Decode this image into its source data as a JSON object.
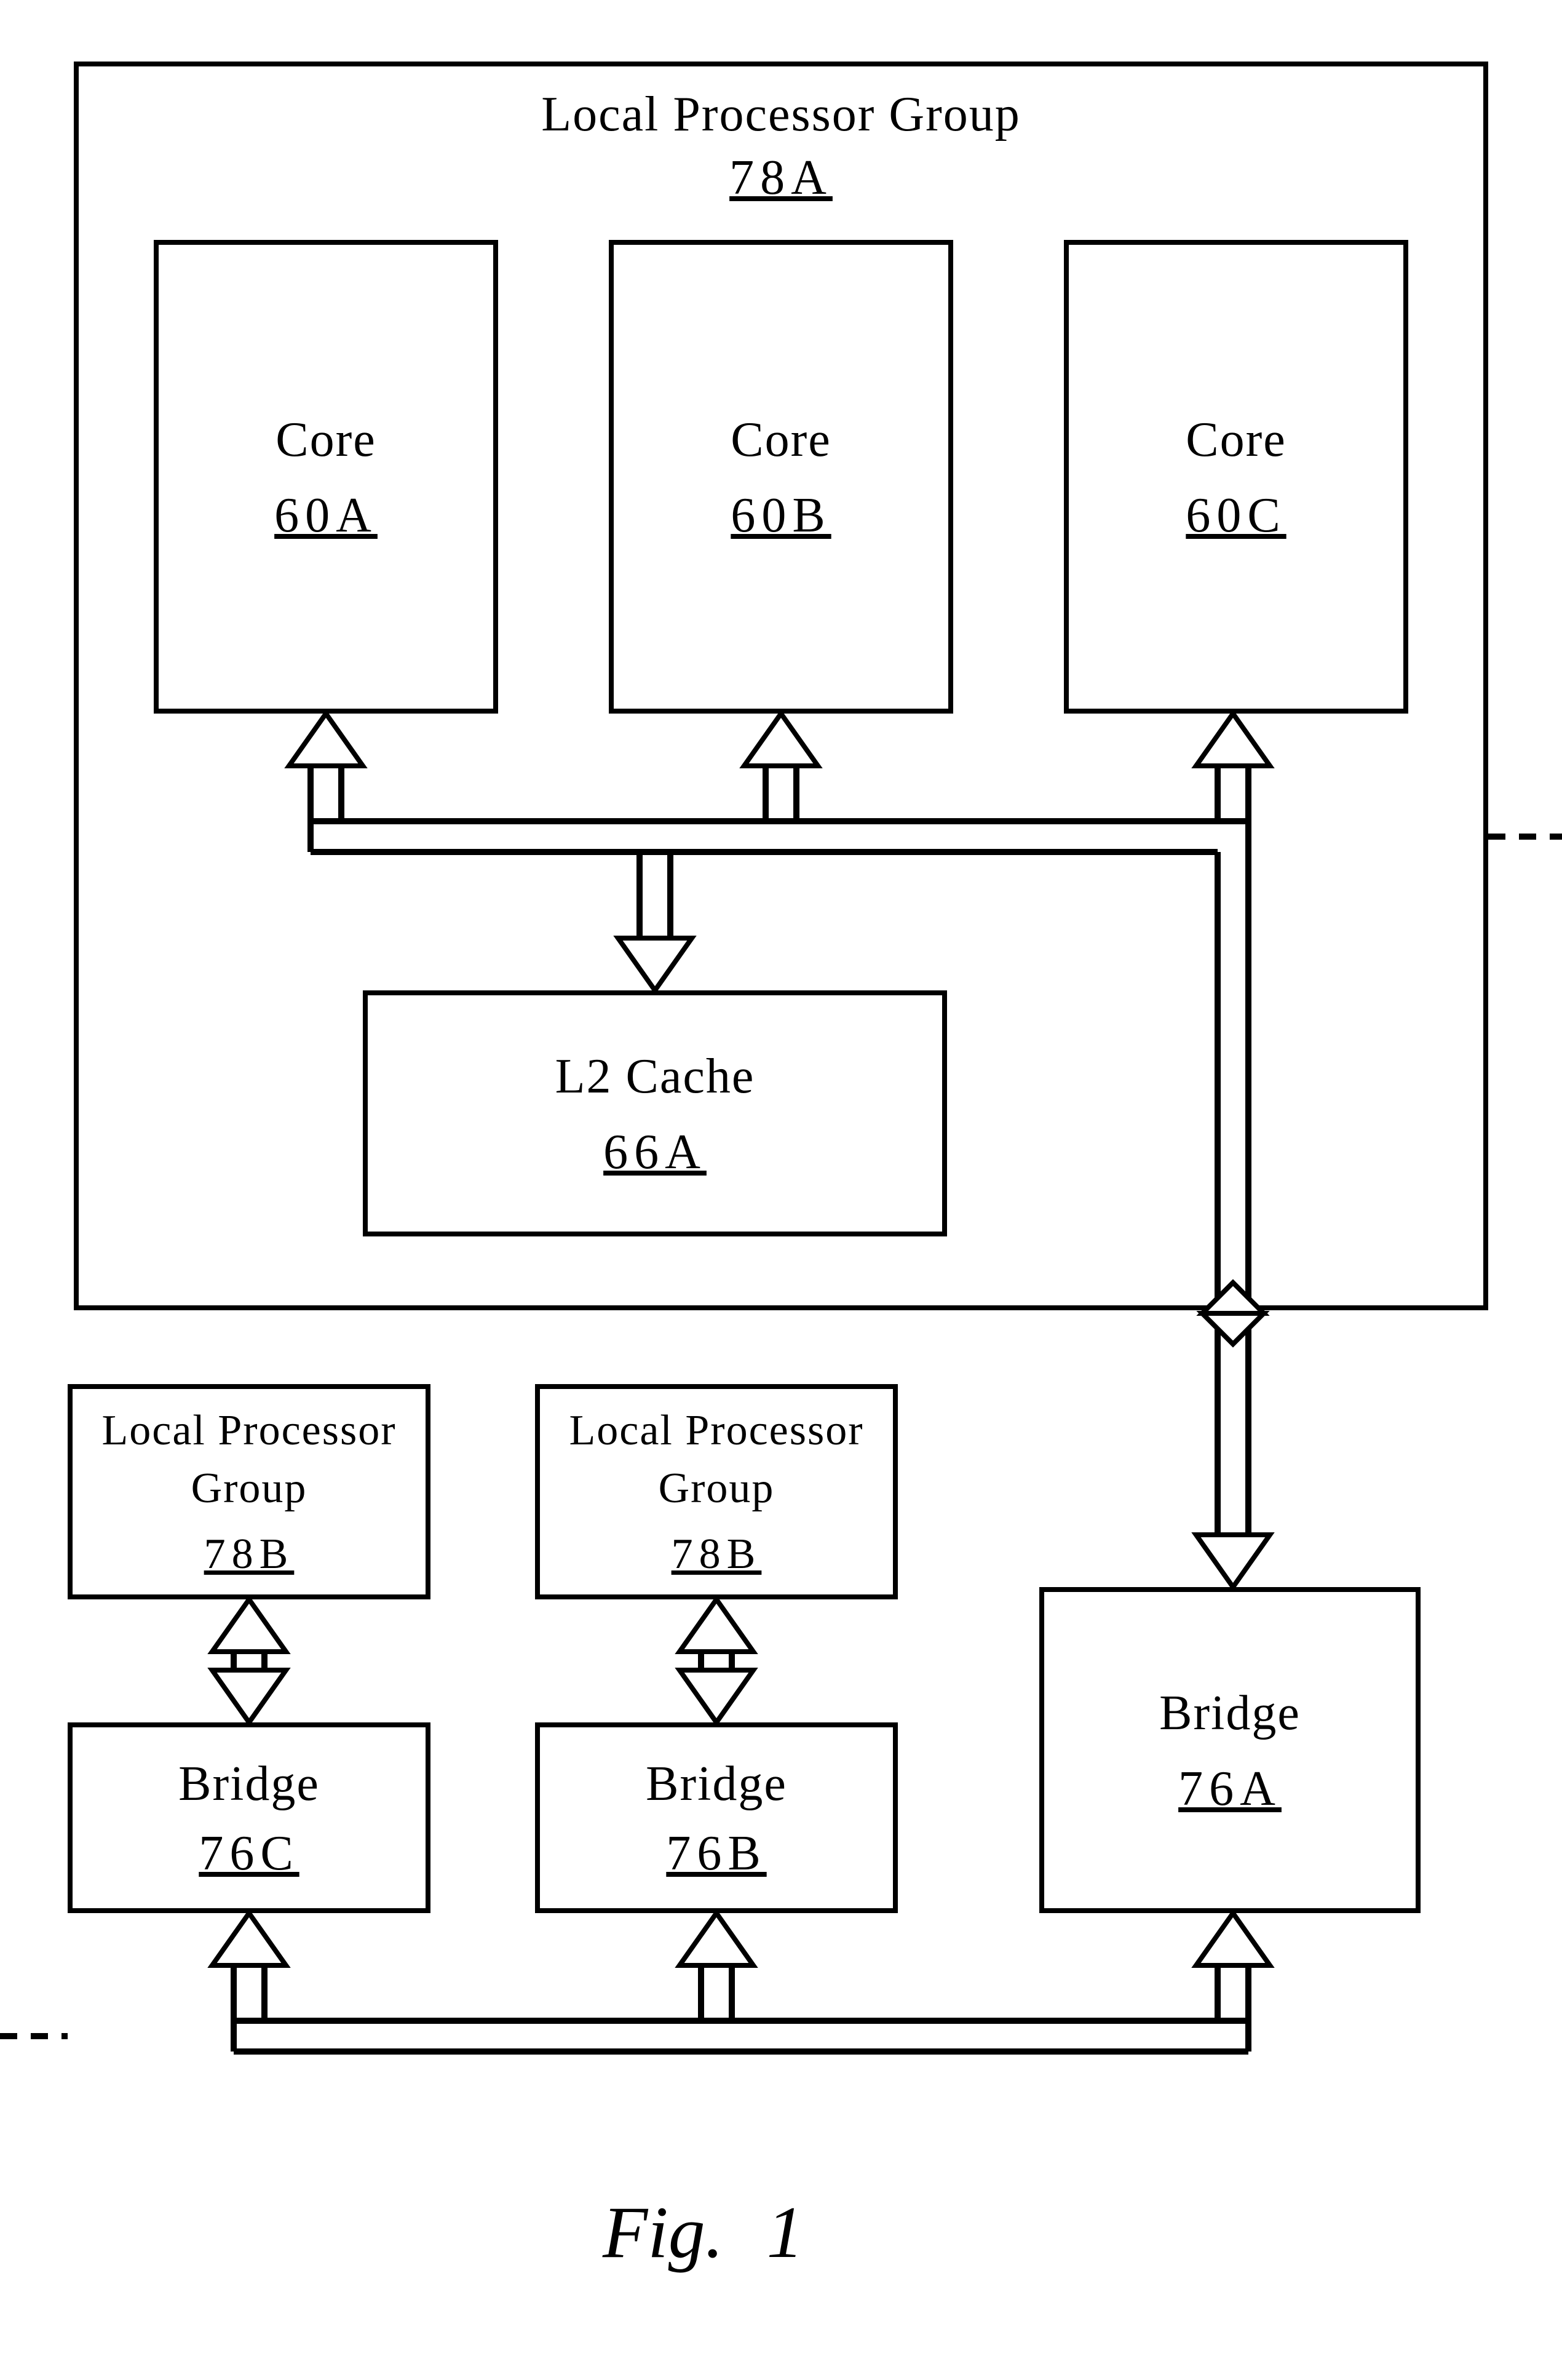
{
  "group78a": {
    "title": "Local Processor Group",
    "ref": "78A"
  },
  "core60a": {
    "title": "Core",
    "ref": "60A"
  },
  "core60b": {
    "title": "Core",
    "ref": "60B"
  },
  "core60c": {
    "title": "Core",
    "ref": "60C"
  },
  "l2cache": {
    "title": "L2 Cache",
    "ref": "66A"
  },
  "group78b_left": {
    "line1": "Local Processor",
    "line2": "Group",
    "ref": "78B"
  },
  "group78b_mid": {
    "line1": "Local Processor",
    "line2": "Group",
    "ref": "78B"
  },
  "bridge76a": {
    "title": "Bridge",
    "ref": "76A"
  },
  "bridge76b": {
    "title": "Bridge",
    "ref": "76B"
  },
  "bridge76c": {
    "title": "Bridge",
    "ref": "76C"
  },
  "figure": {
    "label": "Fig.",
    "num": "1"
  }
}
